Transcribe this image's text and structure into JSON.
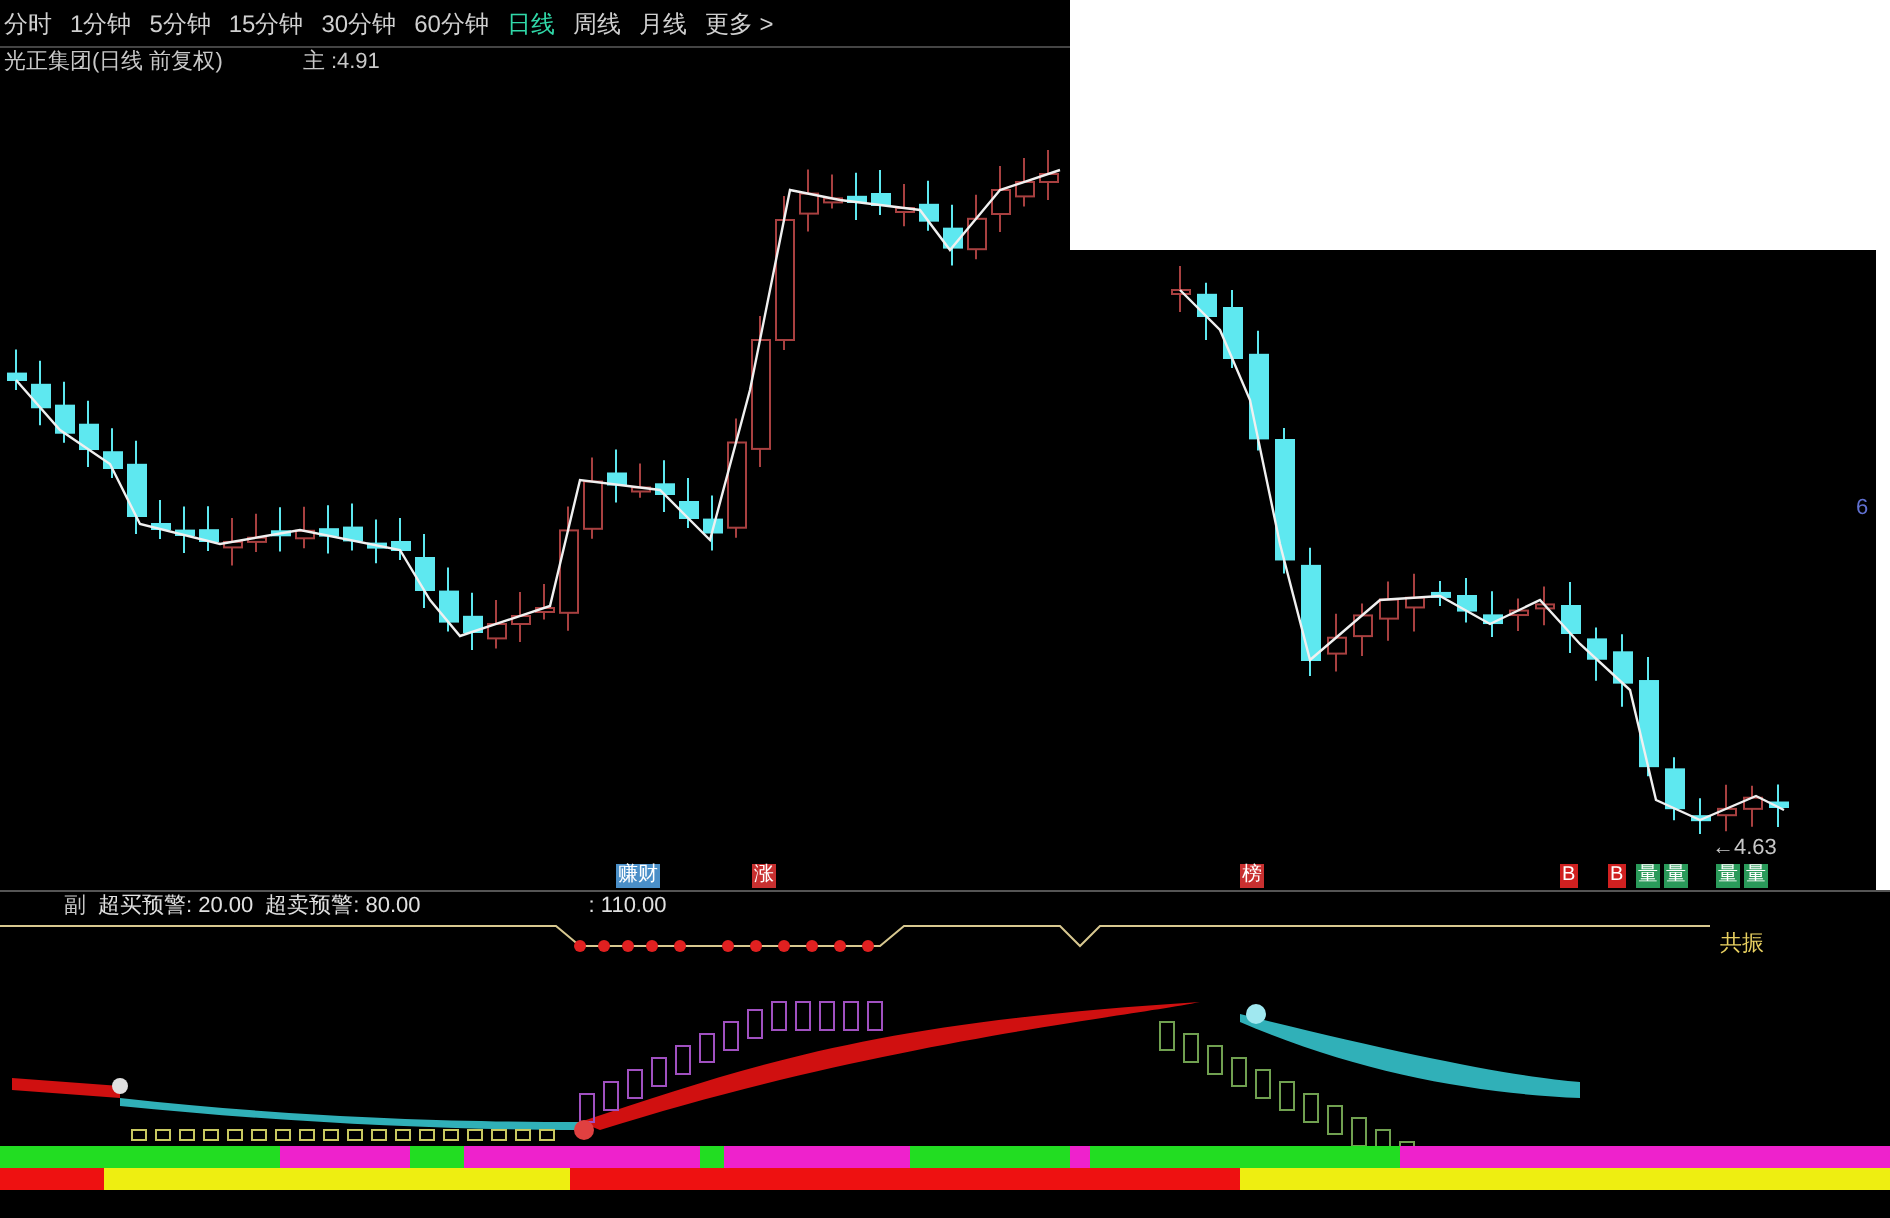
{
  "timeframe_tabs": [
    {
      "label": "分时",
      "selected": false
    },
    {
      "label": "1分钟",
      "selected": false
    },
    {
      "label": "5分钟",
      "selected": false
    },
    {
      "label": "15分钟",
      "selected": false
    },
    {
      "label": "30分钟",
      "selected": false
    },
    {
      "label": "60分钟",
      "selected": false
    },
    {
      "label": "日线",
      "selected": true
    },
    {
      "label": "周线",
      "selected": false
    },
    {
      "label": "月线",
      "selected": false
    },
    {
      "label": "更多 >",
      "selected": false
    }
  ],
  "chart_title": "光正集团(日线 前复权)",
  "price_label": "主 :4.91",
  "axis_label": "6",
  "last_price": "←4.63",
  "signal_badges": [
    {
      "text": "赚财",
      "color": "#4a8fc8"
    },
    {
      "text": "涨",
      "color": "#c83030"
    },
    {
      "text": "榜",
      "color": "#c83030"
    },
    {
      "text": "B",
      "color": "#d02020"
    },
    {
      "text": "B",
      "color": "#d02020"
    },
    {
      "text": "量",
      "color": "#2a9a5a"
    },
    {
      "text": "量",
      "color": "#2a9a5a"
    },
    {
      "text": "量",
      "color": "#2a9a5a"
    },
    {
      "text": "量",
      "color": "#2a9a5a"
    }
  ],
  "indicator": {
    "name": "副",
    "overbought_label": "超买预警: 20.00",
    "oversold_label": "超卖预警: 80.00",
    "level_value": ": 110.00",
    "resonance_tag": "共振"
  }
}
